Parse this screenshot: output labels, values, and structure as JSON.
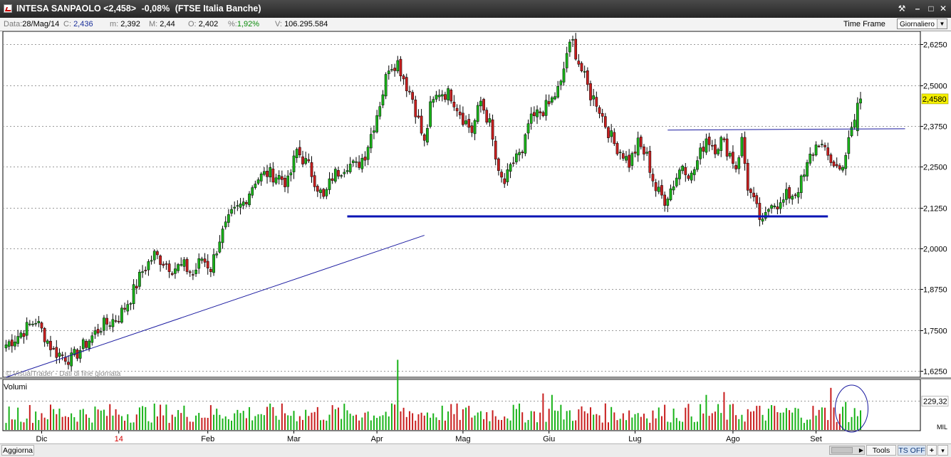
{
  "window": {
    "title_parts": [
      "INTESA SANPAOLO <2,458>",
      "-0,08%",
      "(FTSE Italia Banche)"
    ],
    "controls": [
      "wrench-icon",
      "minimize-icon",
      "maximize-icon",
      "close-icon"
    ]
  },
  "infobar": {
    "date_label": "Data:",
    "date_value": "28/Mag/14",
    "close_label": "C:",
    "close_value": "2,436",
    "min_label": "m:",
    "min_value": "2,392",
    "max_label": "M:",
    "max_value": "2,44",
    "open_label": "O:",
    "open_value": "2,402",
    "pct_label": "%:",
    "pct_value": "1,92%",
    "vol_label": "V:",
    "vol_value": "106.295.584",
    "timeframe_label": "Time Frame",
    "timeframe_value": "Giornaliero"
  },
  "colors": {
    "up": "#19b319",
    "down": "#c81e1e",
    "trend": "#1a1aa0",
    "support": "#0a14b4",
    "price_badge": "#f5f000"
  },
  "chart_data": {
    "type": "candlestick",
    "title": "INTESA SANPAOLO",
    "watermark": "© VisualTrader - Dati di fine giornata",
    "y_axis": {
      "ylim": [
        1.605,
        2.665
      ],
      "ticks": [
        "2,6250",
        "2,5000",
        "2,3750",
        "2,2500",
        "2,1250",
        "2,0000",
        "1,8750",
        "1,7500",
        "1,6250"
      ]
    },
    "last_price": "2,4580",
    "x_labels": [
      {
        "label": "Dic",
        "bar": 12
      },
      {
        "label": "14",
        "bar": 38
      },
      {
        "label": "Feb",
        "bar": 68
      },
      {
        "label": "Mar",
        "bar": 97
      },
      {
        "label": "Apr",
        "bar": 125
      },
      {
        "label": "Mag",
        "bar": 154
      },
      {
        "label": "Giu",
        "bar": 183
      },
      {
        "label": "Lug",
        "bar": 212
      },
      {
        "label": "Ago",
        "bar": 245
      },
      {
        "label": "Set",
        "bar": 273
      }
    ],
    "x_label_colors": {
      "14": "#d00000"
    },
    "anchors": [
      [
        0,
        1.705
      ],
      [
        3,
        1.725
      ],
      [
        10,
        1.78
      ],
      [
        16,
        1.685
      ],
      [
        22,
        1.66
      ],
      [
        26,
        1.7
      ],
      [
        32,
        1.76
      ],
      [
        38,
        1.79
      ],
      [
        42,
        1.85
      ],
      [
        46,
        1.93
      ],
      [
        50,
        1.98
      ],
      [
        56,
        1.94
      ],
      [
        60,
        1.945
      ],
      [
        63,
        1.92
      ],
      [
        66,
        1.97
      ],
      [
        69,
        1.94
      ],
      [
        72,
        2.03
      ],
      [
        76,
        2.1
      ],
      [
        80,
        2.14
      ],
      [
        84,
        2.21
      ],
      [
        88,
        2.23
      ],
      [
        92,
        2.22
      ],
      [
        95,
        2.2
      ],
      [
        98,
        2.3
      ],
      [
        102,
        2.25
      ],
      [
        107,
        2.15
      ],
      [
        110,
        2.22
      ],
      [
        115,
        2.26
      ],
      [
        118,
        2.25
      ],
      [
        121,
        2.29
      ],
      [
        124,
        2.38
      ],
      [
        127,
        2.48
      ],
      [
        129,
        2.56
      ],
      [
        132,
        2.57
      ],
      [
        135,
        2.5
      ],
      [
        137,
        2.46
      ],
      [
        139,
        2.39
      ],
      [
        141,
        2.32
      ],
      [
        143,
        2.43
      ],
      [
        146,
        2.48
      ],
      [
        150,
        2.47
      ],
      [
        154,
        2.4
      ],
      [
        157,
        2.36
      ],
      [
        160,
        2.45
      ],
      [
        163,
        2.38
      ],
      [
        166,
        2.22
      ],
      [
        168,
        2.2
      ],
      [
        170,
        2.24
      ],
      [
        172,
        2.29
      ],
      [
        174,
        2.28
      ],
      [
        176,
        2.38
      ],
      [
        179,
        2.41
      ],
      [
        183,
        2.44
      ],
      [
        187,
        2.5
      ],
      [
        189,
        2.6
      ],
      [
        191,
        2.63
      ],
      [
        193,
        2.57
      ],
      [
        195,
        2.52
      ],
      [
        197,
        2.47
      ],
      [
        199,
        2.45
      ],
      [
        202,
        2.38
      ],
      [
        205,
        2.32
      ],
      [
        208,
        2.29
      ],
      [
        210,
        2.26
      ],
      [
        213,
        2.32
      ],
      [
        216,
        2.28
      ],
      [
        219,
        2.18
      ],
      [
        222,
        2.15
      ],
      [
        225,
        2.2
      ],
      [
        228,
        2.26
      ],
      [
        231,
        2.22
      ],
      [
        234,
        2.29
      ],
      [
        236,
        2.34
      ],
      [
        239,
        2.31
      ],
      [
        241,
        2.33
      ],
      [
        244,
        2.29
      ],
      [
        246,
        2.25
      ],
      [
        248,
        2.33
      ],
      [
        250,
        2.19
      ],
      [
        252,
        2.14
      ],
      [
        255,
        2.07
      ],
      [
        258,
        2.15
      ],
      [
        261,
        2.13
      ],
      [
        263,
        2.16
      ],
      [
        266,
        2.17
      ],
      [
        269,
        2.22
      ],
      [
        271,
        2.28
      ],
      [
        274,
        2.33
      ],
      [
        276,
        2.29
      ],
      [
        279,
        2.26
      ],
      [
        281,
        2.24
      ],
      [
        283,
        2.29
      ],
      [
        285,
        2.36
      ],
      [
        288,
        2.456
      ]
    ],
    "highlight_last": [
      2.36,
      2.458
    ],
    "lines": [
      {
        "name": "trendline",
        "from": [
          0,
          1.605
        ],
        "to": [
          141,
          2.04
        ],
        "color": "#1a1aa0",
        "width": 1
      },
      {
        "name": "support-line",
        "from": [
          115,
          2.0978
        ],
        "to": [
          277,
          2.0978
        ],
        "color": "#0a14b4",
        "width": 3
      },
      {
        "name": "resistance-line",
        "from": [
          223,
          2.3625
        ],
        "to": [
          303,
          2.3665
        ],
        "color": "#1a1aa0",
        "width": 1
      }
    ],
    "volume": {
      "label": "Volumi",
      "level_label": "229,32",
      "unit_label": "MIL",
      "spikes": [
        [
          132,
          2.5
        ],
        [
          181,
          1.3
        ],
        [
          184,
          1.25
        ],
        [
          236,
          1.25
        ],
        [
          242,
          1.35
        ],
        [
          278,
          1.5
        ],
        [
          283,
          1.0
        ]
      ],
      "annotation": "ellipse around last bars"
    }
  },
  "bottom": {
    "left_button": "Aggiorna",
    "tools_label": "Tools",
    "ts_label": "TS OFF",
    "plus": "+",
    "arrow": "▾"
  }
}
